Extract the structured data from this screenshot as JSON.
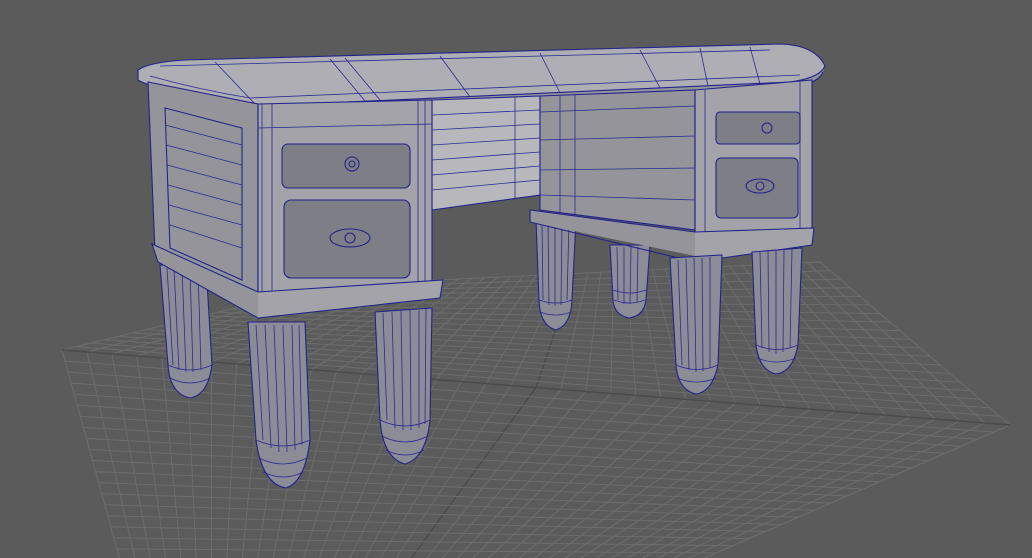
{
  "viewport": {
    "background_color": "#5b5b5b",
    "grid_color": "#6d6d6d",
    "wireframe_color": "#23238a",
    "shaded_color": "#a8a8ae"
  },
  "scene": {
    "object": "desk-wireframe-on-shaded",
    "display_mode": "wireframe-on-shaded",
    "grid_visible": true
  }
}
